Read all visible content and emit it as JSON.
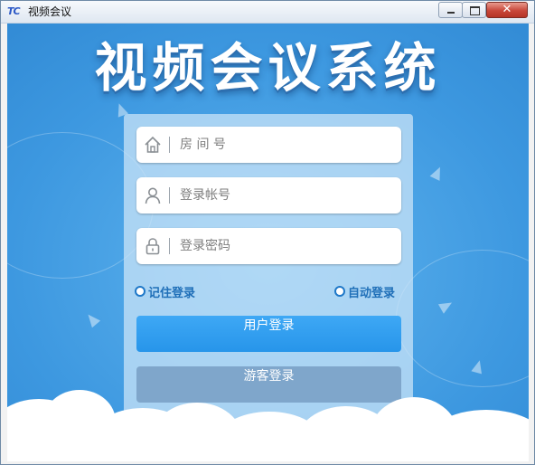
{
  "window": {
    "title": "视频会议",
    "logo_text": "TC",
    "close_glyph": "✕"
  },
  "banner": {
    "headline": "视频会议系统"
  },
  "form": {
    "room": {
      "placeholder": "房 间 号",
      "value": "",
      "icon": "home-icon"
    },
    "account": {
      "placeholder": "登录帐号",
      "value": "",
      "icon": "user-icon"
    },
    "password": {
      "placeholder": "登录密码",
      "value": "",
      "icon": "lock-icon"
    },
    "remember_label": "记住登录",
    "auto_login_label": "自动登录",
    "login_button": "用户登录",
    "guest_button": "游客登录"
  },
  "colors": {
    "accent": "#2795ea",
    "guest_button": "#7fa6cb",
    "background": "#3d98e0"
  }
}
